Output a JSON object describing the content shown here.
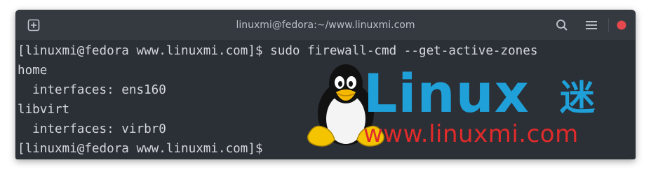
{
  "window": {
    "title": "linuxmi@fedora:~/www.linuxmi.com"
  },
  "titlebar": {
    "new_tab_icon": "new-tab-icon",
    "search_icon": "search-icon",
    "menu_icon": "hamburger-menu-icon",
    "close_icon": "close-icon",
    "close_color": "#e5484d"
  },
  "terminal": {
    "lines": [
      "[linuxmi@fedora www.linuxmi.com]$ sudo firewall-cmd --get-active-zones",
      "home",
      "  interfaces: ens160",
      "libvirt",
      "  interfaces: virbr0",
      "[linuxmi@fedora www.linuxmi.com]$ "
    ],
    "foreground": "#d4d7dc",
    "background": "#2b2f36"
  },
  "watermark": {
    "word": "Linux",
    "word_cn": "迷",
    "url": "www.linuxmi.com",
    "word_color": "#1fa0d8",
    "url_color": "#e02b2b"
  }
}
